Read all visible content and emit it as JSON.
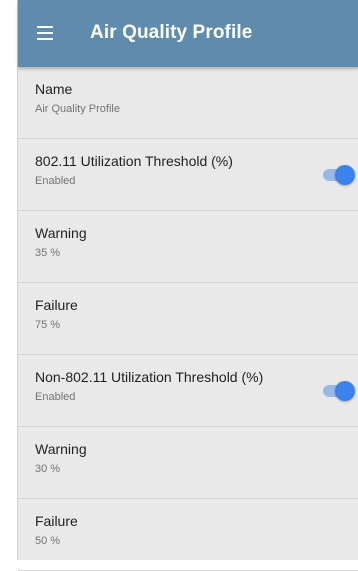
{
  "header": {
    "menu_icon": "hamburger-menu-icon",
    "title": "Air Quality Profile"
  },
  "settings": [
    {
      "title": "Name",
      "value": "Air Quality Profile"
    },
    {
      "title": "802.11 Utilization Threshold (%)",
      "value": "Enabled",
      "toggle": true
    },
    {
      "title": "Warning",
      "value": "35 %"
    },
    {
      "title": "Failure",
      "value": "75 %"
    },
    {
      "title": "Non-802.11 Utilization Threshold (%)",
      "value": "Enabled",
      "toggle": true
    },
    {
      "title": "Warning",
      "value": "30 %"
    },
    {
      "title": "Failure",
      "value": "50 %"
    }
  ],
  "colors": {
    "app_bar": "#5e8bae",
    "toggle_on": "#3a82f0",
    "background": "#e9e9e9"
  }
}
